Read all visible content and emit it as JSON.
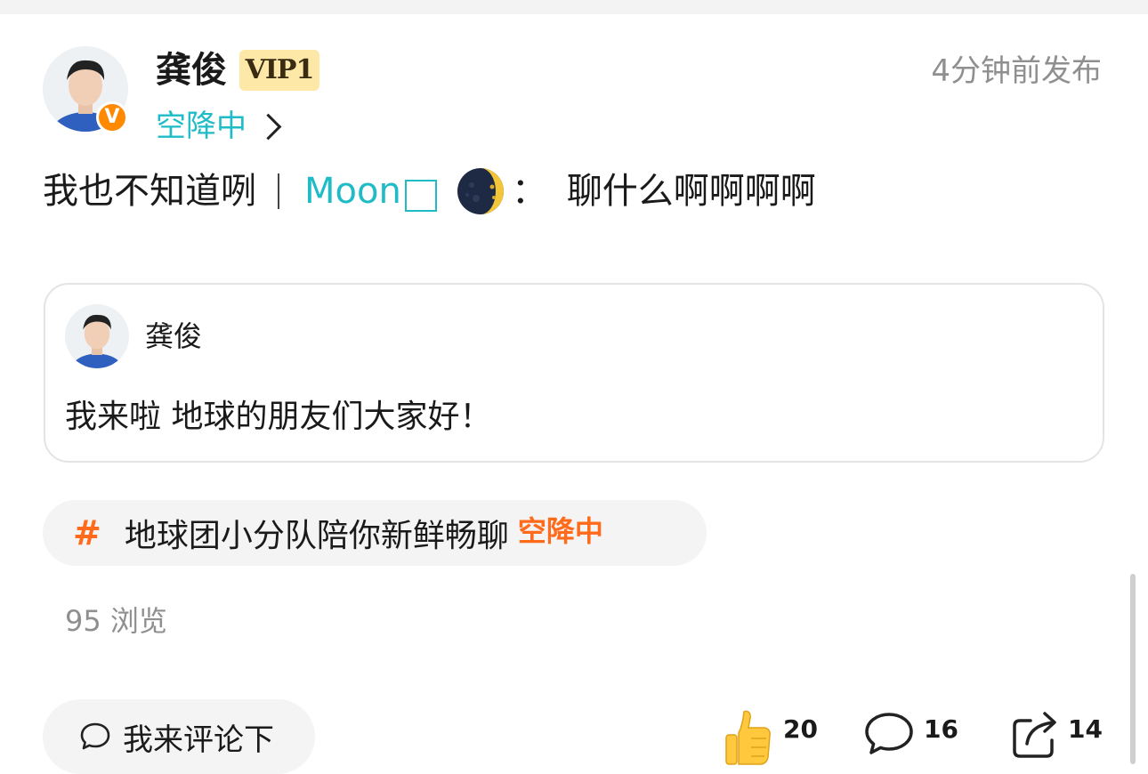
{
  "post": {
    "author_name": "龚俊",
    "vip_label": "VIP1",
    "verified_mark": "V",
    "status_text": "空降中",
    "time": "4分钟前发布",
    "text_main": "我也不知道咧",
    "mention_name": "Moon",
    "colon": "：",
    "text_reply": "聊什么啊啊啊啊",
    "views": "95 浏览"
  },
  "quote": {
    "author_name": "龚俊",
    "text": "我来啦 地球的朋友们大家好！"
  },
  "topic": {
    "hash": "#",
    "text": "地球团小分队陪你新鲜畅聊",
    "tag": "空降中"
  },
  "actions": {
    "comment_placeholder": "我来评论下",
    "like_count": "20",
    "comment_count": "16",
    "share_count": "14"
  },
  "colors": {
    "accent_teal": "#1fbcc8",
    "accent_orange": "#ff6b1a",
    "vip_bg": "#fde8a8"
  },
  "icons": {
    "like": "thumbs-up-icon",
    "comment": "speech-bubble-icon",
    "share": "share-icon",
    "chevron": "chevron-right-icon",
    "moon": "waning-crescent-moon-icon"
  }
}
